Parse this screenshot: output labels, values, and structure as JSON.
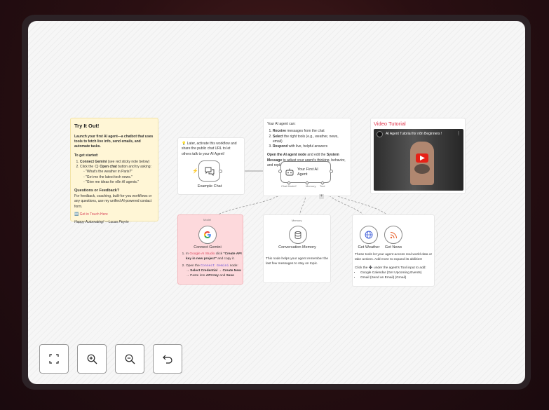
{
  "try_it_out": {
    "title": "Try It Out!",
    "intro": "Launch your first AI agent—a chatbot that uses tools to fetch live info, send emails, and automate tasks.",
    "getting_started_heading": "To get started:",
    "step1_bold": "Connect Gemini",
    "step1_rest": " (see red sticky note below)",
    "step2_pre": "Click the ",
    "step2_bold": "🗨 Open chat",
    "step2_rest": " button and try asking:",
    "examples": [
      "\"What's the weather in Paris?\"",
      "\"Get me the latest tech news.\"",
      "\"Give me ideas for n8n AI agents.\""
    ],
    "questions_heading": "Questions or Feedback?",
    "questions_text": "For feedback, coaching, built-for-you workflows or any questions, use my unified AI-powered contact form.",
    "contact_link": "🆗 Get in Touch Here",
    "signoff": "Happy Automating! —Lucas Peyrin"
  },
  "chat_note": {
    "text": "💡 Later, activate this workflow and share the public chat URL to let others talk to your AI Agent!"
  },
  "agent_note": {
    "line1": "Your AI agent can:",
    "item1_bold": "Receive",
    "item1_rest": " messages from the chat",
    "item2_bold": "Select",
    "item2_rest": " the right tools (e.g., weather, news, email)",
    "item3_bold": "Respond",
    "item3_rest": " with live, helpful answers",
    "p2_b1": "Open the AI agent node",
    "p2_mid": " and edit the ",
    "p2_b2": "System Message",
    "p2_rest": " to adjust your agent's thinking, behavior, and replies."
  },
  "video": {
    "heading": "Video Tutorial",
    "video_title": "AI Agent Tutorial for n8n Beginners !"
  },
  "nodes": {
    "example_chat": "Example Chat",
    "agent_title": "Your First AI Agent",
    "port_chat_model": "Chat Model*",
    "port_memory": "Memory",
    "port_tool": "Tool",
    "model_tag": "Model",
    "memory_tag": "Memory",
    "connect_gemini": "Connect Gemini",
    "conversation_memory": "Conversation Memory",
    "get_weather": "Get Weather",
    "get_news": "Get News"
  },
  "gemini_note": {
    "s1_pre": "In ",
    "s1_link": "Google AI Studio",
    "s1_mid": " click ",
    "s1_bold": "\"Create API key in new project\"",
    "s1_rest": " and copy it.",
    "s2_pre": "Open the ",
    "s2_code": "Connect Gemini",
    "s2_mid": " node: → ",
    "s2_b1": "Select Credential",
    "s2_arrow": " → ",
    "s2_b2": "Create New",
    "s2_mid2": " → Paste into ",
    "s2_b3": "API Key",
    "s2_and": " and ",
    "s2_b4": "Save"
  },
  "memory_note": {
    "text": "This node helps your agent remember the last few messages to stay on topic."
  },
  "tools_note": {
    "p1": "These tools let your agent access real-world data or take actions. Add more to expand its abilities!",
    "p2": "Click the ➕ under the agent's Tool input to add:",
    "items": [
      "Google Calendar (Get Upcoming Events)",
      "Gmail (Send an Email) (Gmail)"
    ]
  },
  "toolbar": {
    "fit_icon": "fit-view-icon",
    "zoom_in_icon": "zoom-in-icon",
    "zoom_out_icon": "zoom-out-icon",
    "undo_icon": "undo-icon"
  },
  "colors": {
    "sticky_yellow": "#fff6d6",
    "sticky_red": "#fdd9dc",
    "accent_red": "#e0344b"
  }
}
